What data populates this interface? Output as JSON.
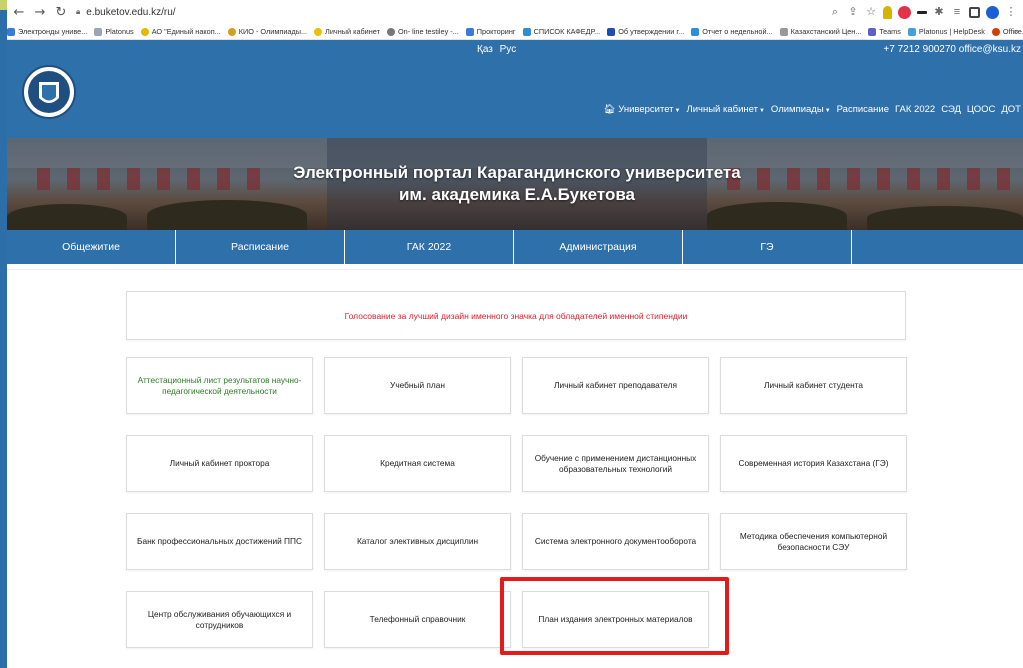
{
  "browser": {
    "url": "e.buketov.edu.kz/ru/",
    "bookmarks": [
      {
        "label": "Электронды униве...",
        "color": "#3a7bd5"
      },
      {
        "label": "Platonus",
        "color": "#9aa5b1"
      },
      {
        "label": "АО \"Единый накоп...",
        "color": "#e6b800"
      },
      {
        "label": "КИО - Олимпиады...",
        "color": "#d4a017"
      },
      {
        "label": "Личный кабинет",
        "color": "#f0c000"
      },
      {
        "label": "On- line testiley -...",
        "color": "#777777"
      },
      {
        "label": "Прокторинг",
        "color": "#3a7bd5"
      },
      {
        "label": "СПИСОК КАФЕДР...",
        "color": "#2a8fd8"
      },
      {
        "label": "Об утверждении г...",
        "color": "#1b4fb3"
      },
      {
        "label": "Отчет о недельной...",
        "color": "#2a8fd8"
      },
      {
        "label": "Казахстанский Цен...",
        "color": "#999999"
      },
      {
        "label": "Teams",
        "color": "#5b5fc7"
      },
      {
        "label": "Platonus | HelpDesk",
        "color": "#44a0d8"
      },
      {
        "label": "Office.com",
        "color": "#d83b01"
      }
    ],
    "bookmarks_more": "»"
  },
  "header": {
    "lang_kz": "Қаз",
    "lang_ru": "Рус",
    "contact": "+7 7212 900270   office@ksu.kz",
    "nav": [
      {
        "label": "Университет",
        "caret": "▼",
        "icon": "home-icon"
      },
      {
        "label": "Личный кабинет",
        "caret": "▼"
      },
      {
        "label": "Олимпиады",
        "caret": "▼"
      },
      {
        "label": "Расписание",
        "caret": ""
      },
      {
        "label": "ГАК 2022",
        "caret": ""
      },
      {
        "label": "СЭД",
        "caret": ""
      },
      {
        "label": "ЦООС",
        "caret": ""
      },
      {
        "label": "ДОТ",
        "caret": ""
      }
    ]
  },
  "banner": {
    "title_line1": "Электронный портал Карагандинского университета",
    "title_line2": "им. академика Е.А.Букетова"
  },
  "menu": [
    "Общежитие",
    "Расписание",
    "ГАК 2022",
    "Администрация",
    "ГЭ",
    ""
  ],
  "announcement": "Голосование за лучший дизайн именного значка для обладателей именной стипендии",
  "tiles": [
    "Аттестационный лист результатов научно-педагогической деятельности",
    "Учебный план",
    "Личный кабинет преподавателя",
    "Личный кабинет студента",
    "Личный кабинет проктора",
    "Кредитная система",
    "Обучение с применением дистанционных образовательных технологий",
    "Современная история Казахстана (ГЭ)",
    "Банк профессиональных достижений ППС",
    "Каталог элективных дисциплин",
    "Система электронного документооборота",
    "Методика обеспечения компьютерной безопасности СЭУ",
    "Центр обслуживания обучающихся и сотрудников",
    "Телефонный справочник",
    "План издания электронных материалов"
  ],
  "colors": {
    "brand_blue": "#2e70aa",
    "announcement_red": "#e0202a",
    "attestation_green": "#2a7d22",
    "highlight_red": "#e41b1b"
  }
}
